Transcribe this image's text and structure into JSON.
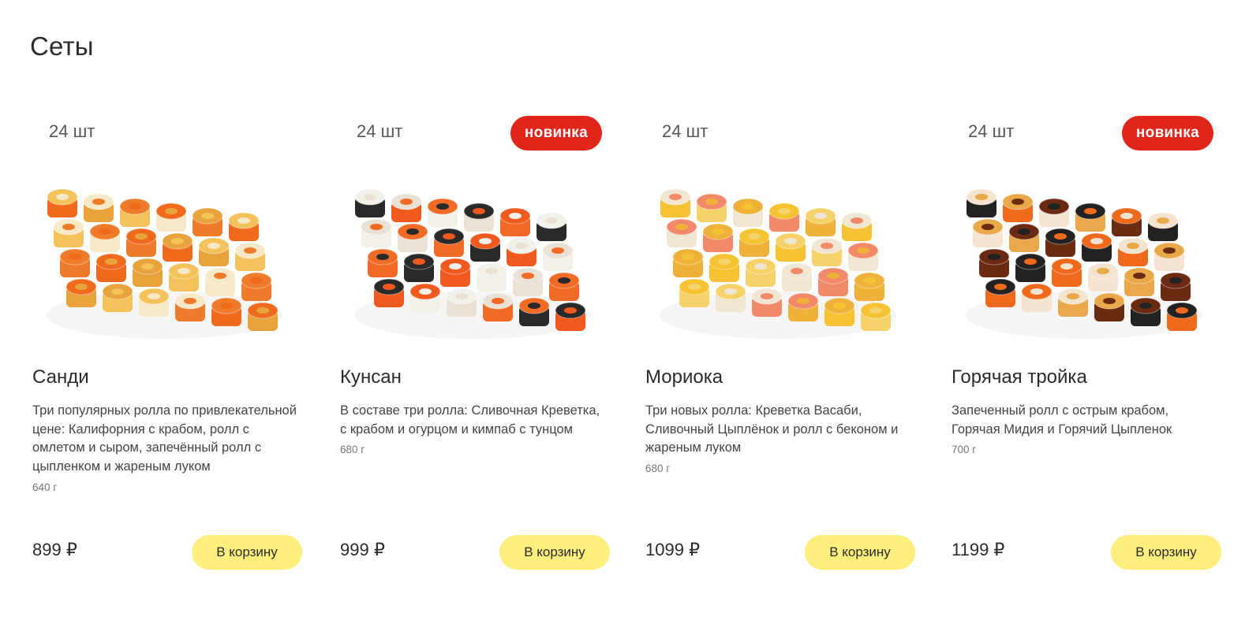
{
  "section_title": "Сеты",
  "products": [
    {
      "pieces": "24 шт",
      "badge": "",
      "name": "Санди",
      "description": "Три популярных ролла по привлекательной цене: Калифорния с крабом, ролл с омлетом и сыром, запечённый ролл с цыпленком и жареным луком",
      "weight": "640 г",
      "price": "899 ₽",
      "cart_label": "В корзину",
      "photo_palette": [
        "#f06a1e",
        "#e8a33c",
        "#f3c25a",
        "#f7e9c8",
        "#ee7b2a"
      ]
    },
    {
      "pieces": "24 шт",
      "badge": "новинка",
      "name": "Кунсан",
      "description": "В составе три ролла: Сливочная Креветка, с крабом и огурцом и кимпаб с тунцом",
      "weight": "680 г",
      "price": "999 ₽",
      "cart_label": "В корзину",
      "photo_palette": [
        "#2a2a2a",
        "#f15a1f",
        "#f3f0ea",
        "#e9e1d3",
        "#f26b26"
      ]
    },
    {
      "pieces": "24 шт",
      "badge": "",
      "name": "Мориока",
      "description": "Три новых ролла: Креветка Васаби, Сливочный Цыплёнок и ролл с беконом и жареным луком",
      "weight": "680 г",
      "price": "1099 ₽",
      "cart_label": "В корзину",
      "photo_palette": [
        "#f4c233",
        "#f6d36a",
        "#f1e6d2",
        "#f28a6a",
        "#efb13a"
      ]
    },
    {
      "pieces": "24 шт",
      "badge": "новинка",
      "name": "Горячая тройка",
      "description": "Запеченный ролл с острым крабом, Горячая Мидия и Горячий Цыпленок",
      "weight": "700 г",
      "price": "1199 ₽",
      "cart_label": "В корзину",
      "photo_palette": [
        "#222222",
        "#f06a1e",
        "#f4e4cf",
        "#e9a84a",
        "#6b2b12"
      ]
    }
  ]
}
